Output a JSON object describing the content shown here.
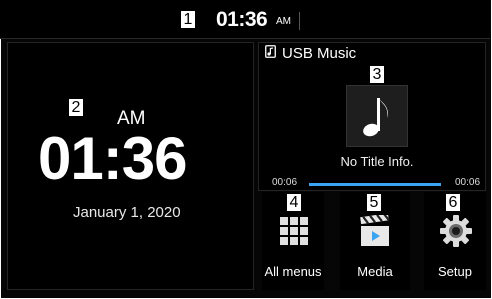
{
  "header": {
    "time": "01:36",
    "ampm": "AM"
  },
  "clock": {
    "ampm": "AM",
    "time": "01:36",
    "date": "January 1, 2020"
  },
  "music": {
    "source": "USB Music",
    "track_info": "No Title Info.",
    "elapsed": "00:06",
    "total": "00:06",
    "progress_fraction": 1.0,
    "progress_color": "#3aa3f2"
  },
  "apps": [
    {
      "label": "All menus",
      "icon": "grid-icon"
    },
    {
      "label": "Media",
      "icon": "clapperboard-icon"
    },
    {
      "label": "Setup",
      "icon": "gear-icon"
    }
  ],
  "callouts": [
    "1",
    "2",
    "3",
    "4",
    "5",
    "6"
  ]
}
